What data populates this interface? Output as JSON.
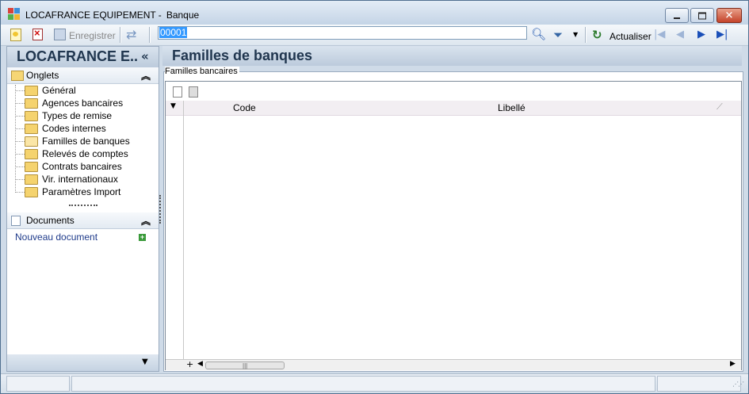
{
  "window": {
    "app_name": "LOCAFRANCE EQUIPEMENT -",
    "module_name": "Banque"
  },
  "toolbar": {
    "save_label": "Enregistrer",
    "search_value": "00001",
    "refresh_label": "Actualiser"
  },
  "left_panel": {
    "title": "LOCAFRANCE E..",
    "collapse_glyph": "«",
    "tabs_section": {
      "label": "Onglets",
      "items": [
        {
          "label": "Général",
          "open": false
        },
        {
          "label": "Agences bancaires",
          "open": false
        },
        {
          "label": "Types de remise",
          "open": false
        },
        {
          "label": "Codes internes",
          "open": false
        },
        {
          "label": "Familles de banques",
          "open": true
        },
        {
          "label": "Relevés de comptes",
          "open": false
        },
        {
          "label": "Contrats bancaires",
          "open": false
        },
        {
          "label": "Vir. internationaux",
          "open": false
        },
        {
          "label": "Paramètres Import",
          "open": false
        }
      ]
    },
    "documents_section": {
      "label": "Documents",
      "new_document_label": "Nouveau document"
    }
  },
  "main": {
    "title": "Familles de banques",
    "group_label": "Familles bancaires",
    "grid": {
      "columns": [
        {
          "label": "Code"
        },
        {
          "label": "Libellé"
        }
      ],
      "rows": []
    }
  }
}
